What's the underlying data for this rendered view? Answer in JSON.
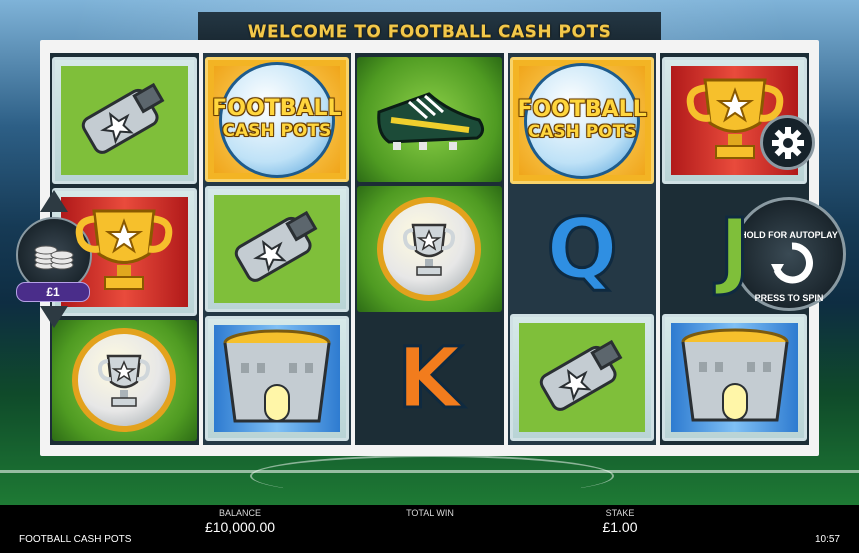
{
  "header": {
    "title": "WELCOME TO FOOTBALL CASH POTS"
  },
  "reels": [
    {
      "symbols": [
        {
          "kind": "whistle",
          "bg": "green"
        },
        {
          "kind": "trophy",
          "bg": "red"
        },
        {
          "kind": "medal",
          "bg": "grass"
        }
      ]
    },
    {
      "symbols": [
        {
          "kind": "logo",
          "bg": "yellow",
          "text1": "FOOTBALL",
          "text2": "CASH POTS"
        },
        {
          "kind": "whistle",
          "bg": "green"
        },
        {
          "kind": "stadium",
          "bg": "blue"
        }
      ]
    },
    {
      "symbols": [
        {
          "kind": "boot",
          "bg": "grass"
        },
        {
          "kind": "medal",
          "bg": "grass"
        },
        {
          "kind": "letter",
          "bg": "plain",
          "text": "K"
        }
      ]
    },
    {
      "symbols": [
        {
          "kind": "logo",
          "bg": "yellow",
          "text1": "FOOTBALL",
          "text2": "CASH POTS"
        },
        {
          "kind": "letter",
          "bg": "plain",
          "text": "Q"
        },
        {
          "kind": "whistle",
          "bg": "green"
        }
      ]
    },
    {
      "symbols": [
        {
          "kind": "trophy",
          "bg": "red"
        },
        {
          "kind": "letter",
          "bg": "plain",
          "text": "J"
        },
        {
          "kind": "stadium",
          "bg": "blue"
        }
      ]
    }
  ],
  "controls": {
    "stake_value": "£1",
    "spin_top_label": "HOLD FOR AUTOPLAY",
    "spin_bottom_label": "PRESS TO SPIN",
    "settings_icon": "gear-icon"
  },
  "footer": {
    "game_name": "FOOTBALL CASH POTS",
    "balance_label": "BALANCE",
    "balance_value": "£10,000.00",
    "total_win_label": "TOTAL WIN",
    "total_win_value": "",
    "stake_label": "STAKE",
    "stake_value": "£1.00",
    "clock": "10:57"
  },
  "colors": {
    "title_gold": "#f2c84b",
    "logo_yellow": "#f3b424",
    "stake_pill": "#4a2d8a",
    "letter_q": "#2f8fe2",
    "letter_k": "#f27c1d",
    "letter_j": "#7fbf3a"
  }
}
